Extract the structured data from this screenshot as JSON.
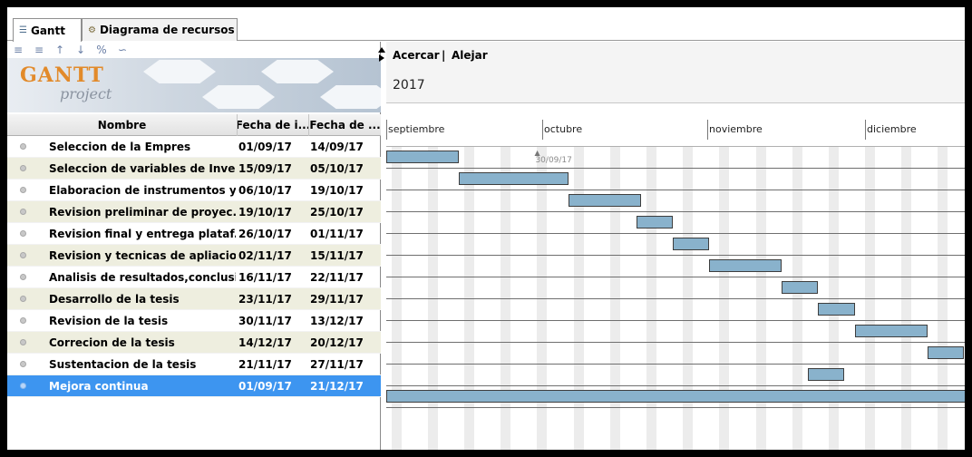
{
  "tabs": [
    {
      "label": "Gantt",
      "icon": "gantt-icon"
    },
    {
      "label": "Diagrama de recursos",
      "icon": "resources-icon"
    }
  ],
  "toolbar": {
    "icons": [
      "indent-icon",
      "outdent-icon",
      "move-up-icon",
      "move-down-icon",
      "link-icon",
      "unlink-icon"
    ]
  },
  "logo": {
    "word": "GANTT",
    "sub": "project"
  },
  "table": {
    "columns": [
      "Nombre",
      "Fecha de i...",
      "Fecha de ..."
    ],
    "rows": [
      {
        "name": "Seleccion de la Empres",
        "start": "01/09/17",
        "end": "14/09/17"
      },
      {
        "name": "Seleccion de variables de Inve...",
        "start": "15/09/17",
        "end": "05/10/17"
      },
      {
        "name": "Elaboracion de instrumentos y...",
        "start": "06/10/17",
        "end": "19/10/17"
      },
      {
        "name": "Revision preliminar de proyec...",
        "start": "19/10/17",
        "end": "25/10/17"
      },
      {
        "name": "Revision final y entrega plataf...",
        "start": "26/10/17",
        "end": "01/11/17"
      },
      {
        "name": "Revision y tecnicas de apliacio...",
        "start": "02/11/17",
        "end": "15/11/17"
      },
      {
        "name": "Analisis de resultados,conclusi...",
        "start": "16/11/17",
        "end": "22/11/17"
      },
      {
        "name": "Desarrollo de la tesis",
        "start": "23/11/17",
        "end": "29/11/17"
      },
      {
        "name": "Revision de la tesis",
        "start": "30/11/17",
        "end": "13/12/17"
      },
      {
        "name": "Correcion de la tesis",
        "start": "14/12/17",
        "end": "20/12/17"
      },
      {
        "name": "Sustentacion de la tesis",
        "start": "21/11/17",
        "end": "27/11/17"
      },
      {
        "name": "Mejora continua",
        "start": "01/09/17",
        "end": "21/12/17",
        "selected": true
      }
    ]
  },
  "chart": {
    "zoom_in": "Acercar",
    "separator": "|",
    "zoom_out": "Alejar",
    "year": "2017",
    "months": [
      "septiembre",
      "octubre",
      "noviembre",
      "diciembre"
    ],
    "today_label": "30/09/17"
  },
  "colors": {
    "bar": "#89b2cc",
    "selected_row": "#3d95f0",
    "alt_row": "#eeeedf",
    "logo_orange": "#e28a2a"
  }
}
